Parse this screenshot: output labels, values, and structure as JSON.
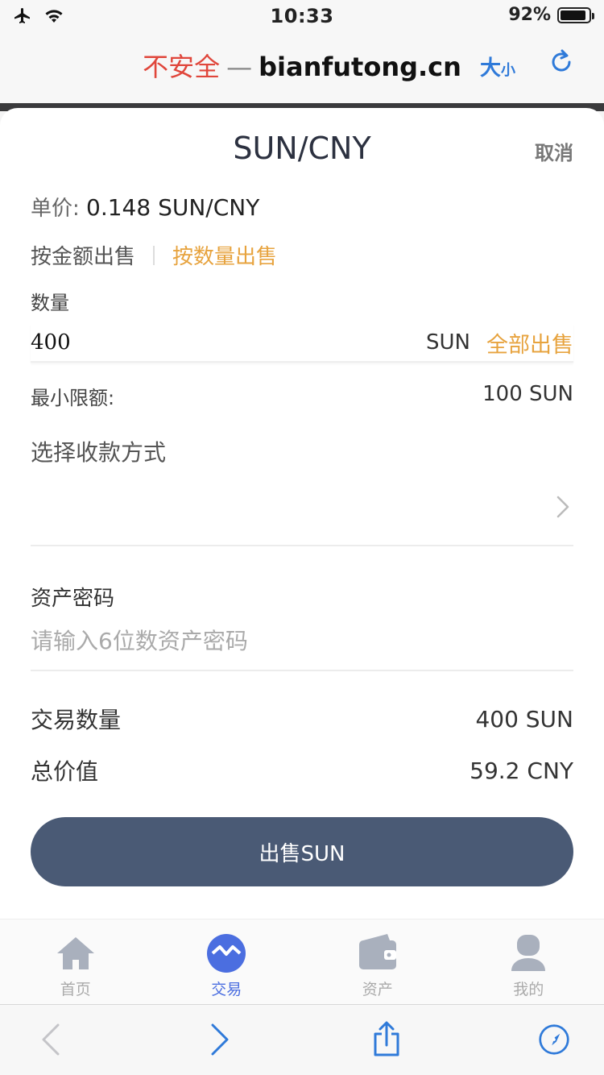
{
  "status": {
    "time": "10:33",
    "battery": "92%",
    "battery_level": 0.92
  },
  "browser": {
    "insecure_label": "不安全",
    "separator": "—",
    "host": "bianfutong.cn",
    "text_size_big": "大",
    "text_size_small": "小"
  },
  "sheet": {
    "title": "SUN/CNY",
    "cancel_label": "取消",
    "unit_price_label": "单价:",
    "unit_price_value": "0.148 SUN/CNY",
    "mode_amount": "按金额出售",
    "mode_quantity": "按数量出售",
    "quantity_label": "数量",
    "quantity_value": "400",
    "quantity_unit": "SUN",
    "sell_all_label": "全部出售",
    "min_limit_label": "最小限额:",
    "min_limit_value": "100 SUN",
    "payment_method_label": "选择收款方式",
    "password_label": "资产密码",
    "password_placeholder": "请输入6位数资产密码",
    "trade_quantity_label": "交易数量",
    "trade_quantity_value": "400 SUN",
    "total_value_label": "总价值",
    "total_value_value": "59.2 CNY",
    "submit_label": "出售SUN"
  },
  "tabs": [
    {
      "label": "首页",
      "icon": "home-icon"
    },
    {
      "label": "交易",
      "icon": "trade-icon"
    },
    {
      "label": "资产",
      "icon": "wallet-icon"
    },
    {
      "label": "我的",
      "icon": "user-icon"
    }
  ],
  "colors": {
    "accent": "#e7a33e",
    "button": "#4a5a75",
    "active_tab": "#4b6ee0",
    "insecure": "#e0463b",
    "link_blue": "#2f7ad9"
  }
}
